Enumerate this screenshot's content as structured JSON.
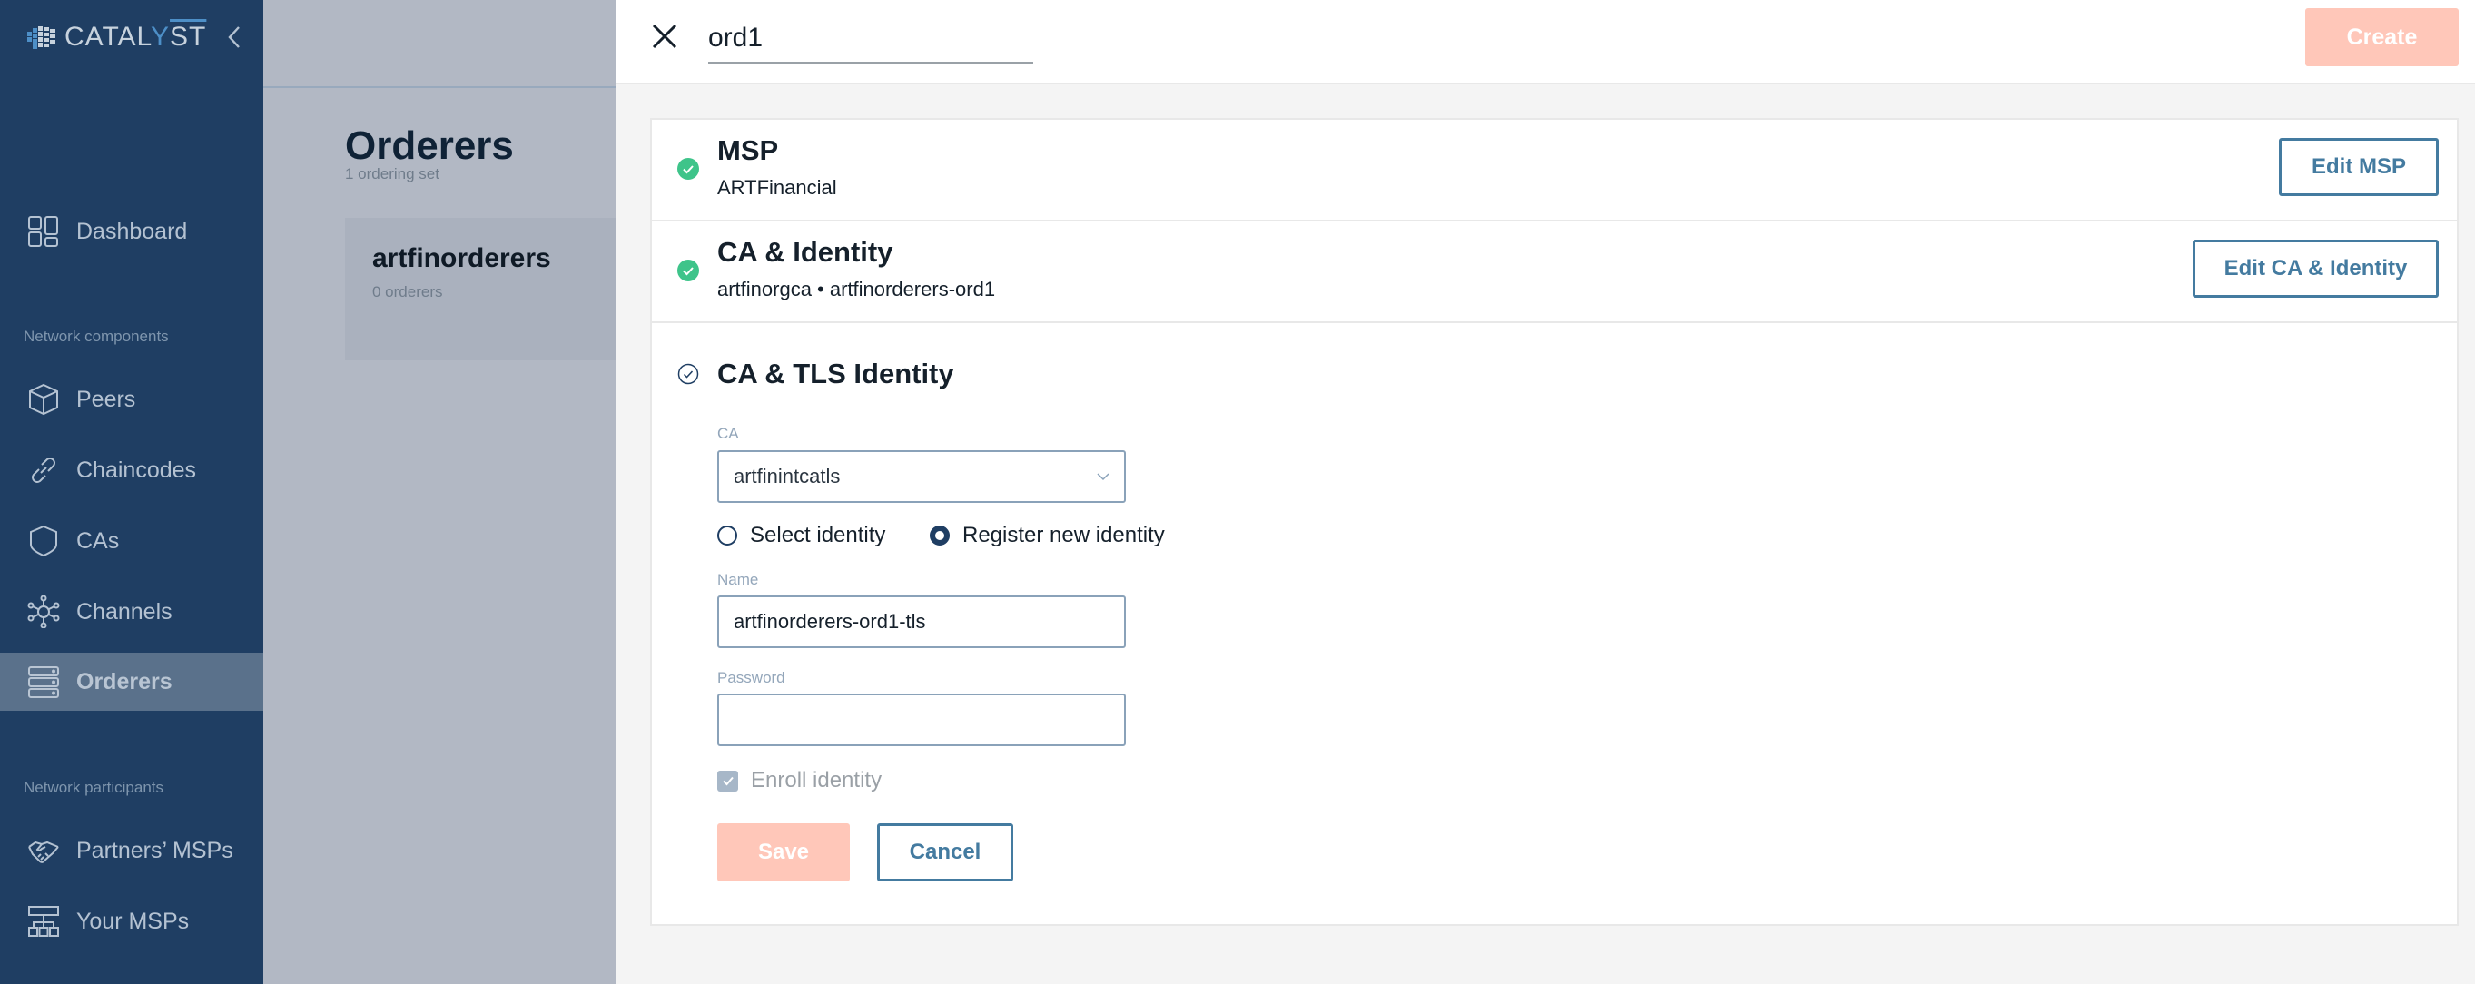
{
  "app": {
    "brand": {
      "prefix": "CATAL",
      "accent": "Y",
      "suffix": "ST",
      "logo_icon": "cube-grid-icon"
    },
    "collapse_icon": "chevron-left-icon"
  },
  "sidebar": {
    "sections": [
      {
        "label": "Network components"
      },
      {
        "label": "Network participants"
      }
    ],
    "items": [
      {
        "label": "Dashboard",
        "icon": "dashboard-icon",
        "active": false
      },
      {
        "label": "Peers",
        "icon": "cube-icon",
        "active": false
      },
      {
        "label": "Chaincodes",
        "icon": "link-icon",
        "active": false
      },
      {
        "label": "CAs",
        "icon": "shield-icon",
        "active": false
      },
      {
        "label": "Channels",
        "icon": "network-hub-icon",
        "active": false
      },
      {
        "label": "Orderers",
        "icon": "server-stack-icon",
        "active": true
      },
      {
        "label": "Partners’ MSPs",
        "icon": "handshake-icon",
        "active": false
      },
      {
        "label": "Your MSPs",
        "icon": "org-chart-icon",
        "active": false
      }
    ]
  },
  "background_page": {
    "title": "Orderers",
    "subtitle": "1 ordering set",
    "cards": [
      {
        "name": "artfinorderers",
        "count": "0 orderers"
      }
    ]
  },
  "panel": {
    "name_value": "ord1",
    "create_label": "Create",
    "steps": [
      {
        "title": "MSP",
        "subtitle": "ARTFinancial",
        "status": "complete",
        "edit_label": "Edit MSP"
      },
      {
        "title": "CA & Identity",
        "subtitle": "artfinorgca • artfinorderers-ord1",
        "status": "complete",
        "edit_label": "Edit CA & Identity"
      },
      {
        "title": "CA & TLS Identity",
        "status": "in-progress"
      }
    ],
    "tls_form": {
      "ca_label": "CA",
      "ca_value": "artfinintcatls",
      "radio_options": [
        {
          "label": "Select identity",
          "selected": false
        },
        {
          "label": "Register new identity",
          "selected": true
        }
      ],
      "name_label": "Name",
      "name_value": "artfinorderers-ord1-tls",
      "password_label": "Password",
      "password_value": "",
      "enroll_label": "Enroll identity",
      "enroll_checked": true,
      "save_label": "Save",
      "cancel_label": "Cancel"
    }
  },
  "colors": {
    "sidebar_bg": "#1f3e63",
    "sidebar_active": "#5a718b",
    "primary_disabled": "#ffc7b9",
    "outline_accent": "#447ba0",
    "success": "#3ec48a"
  }
}
